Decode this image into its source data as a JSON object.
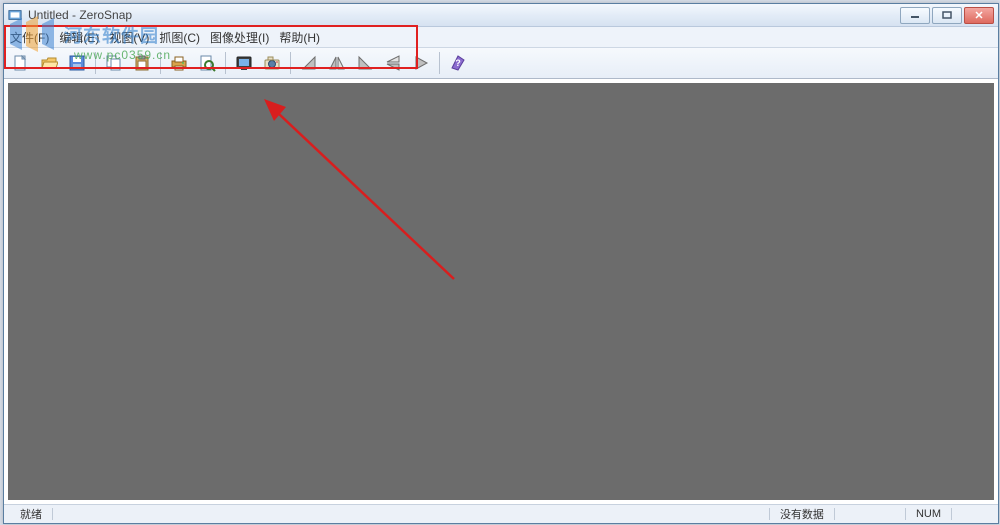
{
  "title": "Untitled - ZeroSnap",
  "menu": {
    "file": "文件(F)",
    "edit": "编辑(E)",
    "view": "视图(V)",
    "capture": "抓图(C)",
    "image": "图像处理(I)",
    "help": "帮助(H)"
  },
  "status": {
    "ready": "就绪",
    "nodata": "没有数据",
    "num": "NUM"
  },
  "watermark": {
    "title": "河东软件园",
    "url": "www.pc0359.cn"
  },
  "toolbar_icons": [
    "new-doc-icon",
    "open-icon",
    "save-icon",
    "sep",
    "copy-icon",
    "paste-icon",
    "sep",
    "print-icon",
    "preview-icon",
    "sep",
    "capture-icon",
    "camera-icon",
    "sep",
    "rotate-left-icon",
    "flip-h-icon",
    "rotate-right-icon",
    "flip-v-icon",
    "play-icon",
    "sep",
    "help-icon"
  ]
}
